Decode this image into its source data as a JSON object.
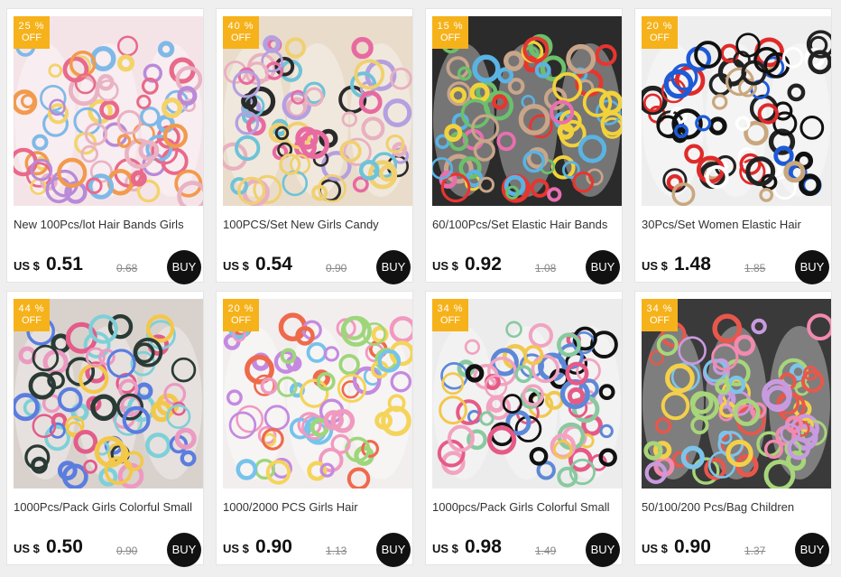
{
  "products": [
    {
      "discount_pct": "25 %",
      "discount_label": "OFF",
      "title": "New 100Pcs/lot Hair Bands Girls",
      "currency": "US $",
      "price": "0.51",
      "old_price": "0.68",
      "buy_label": "BUY",
      "image": "pink box of colorful hair ties",
      "colors": [
        "#e9b3c4",
        "#f3d36a",
        "#7fb9e8",
        "#e86a8a",
        "#b98ad8",
        "#f29a4d"
      ],
      "bg": "#f4e4e8"
    },
    {
      "discount_pct": "40 %",
      "discount_label": "OFF",
      "title": "100PCS/Set New Girls Candy",
      "currency": "US $",
      "price": "0.54",
      "old_price": "0.90",
      "buy_label": "BUY",
      "image": "kraft boxes of hair ties",
      "colors": [
        "#e9b0c0",
        "#6ec3d8",
        "#f0d070",
        "#b4a0e0",
        "#2a2a2a",
        "#e86aa0"
      ],
      "bg": "#e9dccb"
    },
    {
      "discount_pct": "15 %",
      "discount_label": "OFF",
      "title": "60/100Pcs/Set Elastic Hair Bands",
      "currency": "US $",
      "price": "0.92",
      "old_price": "1.08",
      "buy_label": "BUY",
      "image": "bags of scrunchies on dark background",
      "colors": [
        "#e8352f",
        "#f2d23c",
        "#59b4e4",
        "#e96fb0",
        "#6cc06b",
        "#c9a58a"
      ],
      "bg": "#2b2b2b"
    },
    {
      "discount_pct": "20 %",
      "discount_label": "OFF",
      "title": "30Pcs/Set Women Elastic Hair",
      "currency": "US $",
      "price": "1.48",
      "old_price": "1.85",
      "buy_label": "BUY",
      "image": "clear box with red blue black white beige bands",
      "colors": [
        "#111111",
        "#1d5bd8",
        "#e02a2a",
        "#ffffff",
        "#c9a77e",
        "#222222"
      ],
      "bg": "#eeeeee"
    },
    {
      "discount_pct": "44 %",
      "discount_label": "OFF",
      "title": "1000Pcs/Pack Girls Colorful Small",
      "currency": "US $",
      "price": "0.50",
      "old_price": "0.90",
      "buy_label": "BUY",
      "image": "three packs of tiny bands held in hands",
      "colors": [
        "#e35c8a",
        "#5b7de0",
        "#f3c84a",
        "#ec9ac2",
        "#2a3a35",
        "#7ed0d8"
      ],
      "bg": "#d9d2cc"
    },
    {
      "discount_pct": "20 %",
      "discount_label": "OFF",
      "title": "1000/2000 PCS Girls Hair",
      "currency": "US $",
      "price": "0.90",
      "old_price": "1.13",
      "buy_label": "BUY",
      "image": "clear pouches of mini bands",
      "colors": [
        "#f09ac0",
        "#76c3ec",
        "#f4d45a",
        "#ef6a4c",
        "#9ed67a",
        "#c48ae0"
      ],
      "bg": "#f3eeee"
    },
    {
      "discount_pct": "34 %",
      "discount_label": "OFF",
      "title": "1000pcs/Pack Girls Colorful Small",
      "currency": "US $",
      "price": "0.98",
      "old_price": "1.49",
      "buy_label": "BUY",
      "image": "three bags of colorful bands",
      "colors": [
        "#e65a86",
        "#f1c84e",
        "#f2a3c0",
        "#5d88d8",
        "#111111",
        "#89c9a0"
      ],
      "bg": "#ececec"
    },
    {
      "discount_pct": "34 %",
      "discount_label": "OFF",
      "title": "50/100/200 Pcs/Bag Children",
      "currency": "US $",
      "price": "0.90",
      "old_price": "1.37",
      "buy_label": "BUY",
      "image": "zip bags of candy-colored scrunchies",
      "colors": [
        "#f28ab0",
        "#f4d04a",
        "#7cc4ea",
        "#a7d67a",
        "#e8574c",
        "#c89be0"
      ],
      "bg": "#3a3a3a"
    }
  ]
}
